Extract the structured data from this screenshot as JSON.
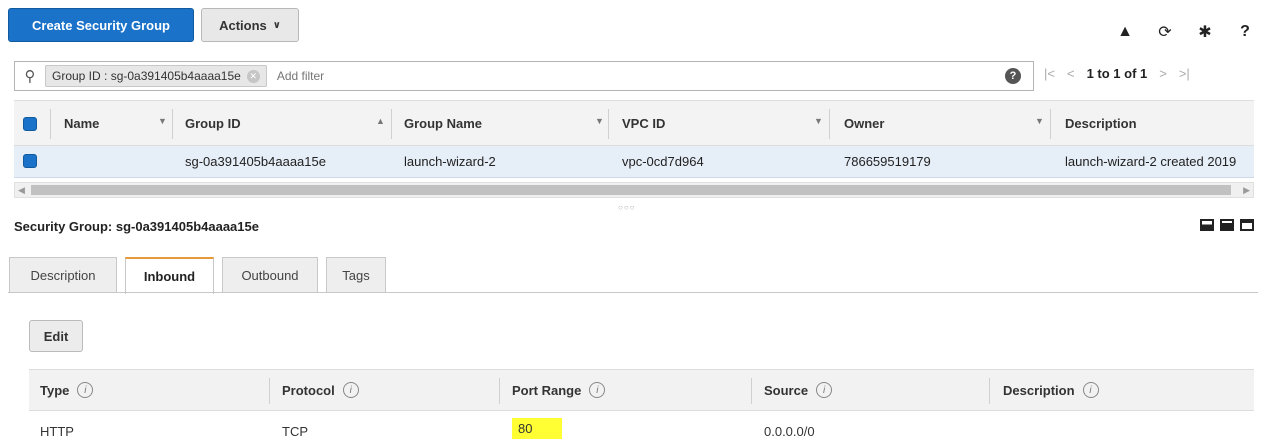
{
  "toolbar": {
    "create_label": "Create Security Group",
    "actions_label": "Actions",
    "icons": [
      "flask-icon",
      "refresh-icon",
      "gear-icon",
      "help-icon"
    ]
  },
  "filter": {
    "token": "Group ID : sg-0a391405b4aaaa15e",
    "placeholder": "Add filter",
    "pager_text": "1 to 1 of 1"
  },
  "grid": {
    "columns": [
      "Name",
      "Group ID",
      "Group Name",
      "VPC ID",
      "Owner",
      "Description"
    ],
    "row": {
      "name": "",
      "group_id": "sg-0a391405b4aaaa15e",
      "group_name": "launch-wizard-2",
      "vpc_id": "vpc-0cd7d964",
      "owner": "786659519179",
      "description": "launch-wizard-2 created 2019"
    }
  },
  "detail": {
    "title": "Security Group: sg-0a391405b4aaaa15e",
    "tabs": [
      "Description",
      "Inbound",
      "Outbound",
      "Tags"
    ],
    "active_tab": "Inbound",
    "edit_label": "Edit",
    "rules_columns": [
      "Type",
      "Protocol",
      "Port Range",
      "Source",
      "Description"
    ],
    "rules": [
      {
        "type": "HTTP",
        "protocol": "TCP",
        "port_range": "80",
        "source": "0.0.0.0/0",
        "description": ""
      }
    ]
  },
  "colors": {
    "primary": "#1a73c9",
    "active_tab": "#e69a3a",
    "highlight": "#ffff33",
    "selected_row": "#e6eef7"
  }
}
